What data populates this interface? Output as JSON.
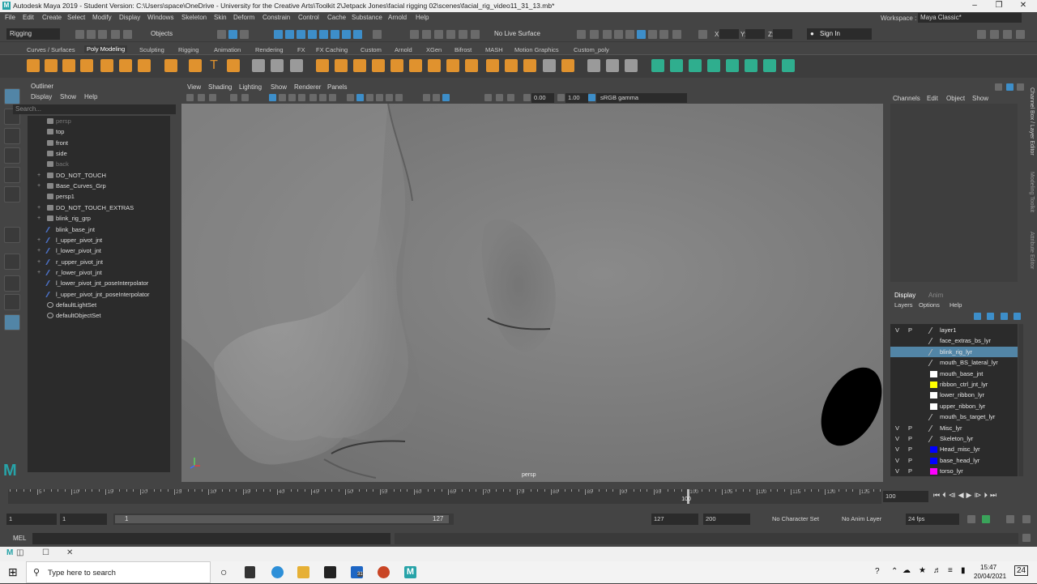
{
  "title_bar": {
    "title": "Autodesk Maya 2019 - Student Version: C:\\Users\\space\\OneDrive - University for the Creative Arts\\Toolkit 2\\Jetpack Jones\\facial rigging 02\\scenes\\facial_rig_video11_31_13.mb*"
  },
  "menu": [
    "File",
    "Edit",
    "Create",
    "Select",
    "Modify",
    "Display",
    "Windows",
    "Skeleton",
    "Skin",
    "Deform",
    "Constrain",
    "Control",
    "Cache",
    "Substance",
    "Arnold",
    "Help"
  ],
  "workspace": {
    "label": "Workspace :",
    "value": "Maya Classic*"
  },
  "status_line": {
    "mode": "Rigging",
    "objects": "Objects",
    "live_surface": "No Live Surface",
    "x_label": "X:",
    "y_label": "Y:",
    "z_label": "Z:",
    "sign_in": "Sign In"
  },
  "shelf_tabs": [
    "Curves / Surfaces",
    "Poly Modeling",
    "Sculpting",
    "Rigging",
    "Animation",
    "Rendering",
    "FX",
    "FX Caching",
    "Custom",
    "Arnold",
    "XGen",
    "Bifrost",
    "MASH",
    "Motion Graphics",
    "Custom_poly"
  ],
  "shelf_active": "Poly Modeling",
  "outliner": {
    "title": "Outliner",
    "menu": [
      "Display",
      "Show",
      "Help"
    ],
    "search_placeholder": "Search...",
    "items": [
      {
        "label": "persp",
        "icon": "camera-icon",
        "dim": true,
        "expand": ""
      },
      {
        "label": "top",
        "icon": "camera-icon",
        "dim": false,
        "expand": ""
      },
      {
        "label": "front",
        "icon": "camera-icon",
        "dim": false,
        "expand": ""
      },
      {
        "label": "side",
        "icon": "camera-icon",
        "dim": false,
        "expand": ""
      },
      {
        "label": "back",
        "icon": "camera-icon",
        "dim": true,
        "expand": ""
      },
      {
        "label": "DO_NOT_TOUCH",
        "icon": "group-icon",
        "dim": false,
        "expand": "+"
      },
      {
        "label": "Base_Curves_Grp",
        "icon": "group-icon",
        "dim": false,
        "expand": "+"
      },
      {
        "label": "persp1",
        "icon": "camera-icon",
        "dim": false,
        "expand": ""
      },
      {
        "label": "DO_NOT_TOUCH_EXTRAS",
        "icon": "group-icon",
        "dim": false,
        "expand": "+"
      },
      {
        "label": "blink_rig_grp",
        "icon": "group-icon",
        "dim": false,
        "expand": "+"
      },
      {
        "label": "blink_base_jnt",
        "icon": "joint-icon",
        "dim": false,
        "expand": ""
      },
      {
        "label": "l_upper_pivot_jnt",
        "icon": "joint-icon",
        "dim": false,
        "expand": "+"
      },
      {
        "label": "l_lower_pivot_jnt",
        "icon": "joint-icon",
        "dim": false,
        "expand": "+"
      },
      {
        "label": "r_upper_pivot_jnt",
        "icon": "joint-icon",
        "dim": false,
        "expand": "+"
      },
      {
        "label": "r_lower_pivot_jnt",
        "icon": "joint-icon",
        "dim": false,
        "expand": "+"
      },
      {
        "label": "l_lower_pivot_jnt_poseInterpolator",
        "icon": "pose-icon",
        "dim": false,
        "expand": ""
      },
      {
        "label": "l_upper_pivot_jnt_poseInterpolator",
        "icon": "pose-icon",
        "dim": false,
        "expand": ""
      },
      {
        "label": "defaultLightSet",
        "icon": "set-icon",
        "dim": false,
        "expand": ""
      },
      {
        "label": "defaultObjectSet",
        "icon": "set-icon",
        "dim": false,
        "expand": ""
      }
    ]
  },
  "viewport": {
    "menu": [
      "View",
      "Shading",
      "Lighting",
      "Show",
      "Renderer",
      "Panels"
    ],
    "exposure": "0.00",
    "gamma_value": "1.00",
    "color_space": "sRGB gamma",
    "camera_label": "persp"
  },
  "channel_box": {
    "menu": [
      "Channels",
      "Edit",
      "Object",
      "Show"
    ]
  },
  "layer_editor": {
    "tabs": [
      "Display",
      "Anim"
    ],
    "menu": [
      "Layers",
      "Options",
      "Help"
    ],
    "layers": [
      {
        "v": "V",
        "p": "P",
        "color": "",
        "name": "layer1",
        "selected": false
      },
      {
        "v": "",
        "p": "",
        "color": "",
        "name": "face_extras_bs_lyr",
        "selected": false
      },
      {
        "v": "",
        "p": "",
        "color": "",
        "name": "blink_rig_lyr",
        "selected": true
      },
      {
        "v": "",
        "p": "",
        "color": "",
        "name": "mouth_BS_lateral_lyr",
        "selected": false
      },
      {
        "v": "",
        "p": "",
        "color": "#ffffff",
        "name": "mouth_base_jnt",
        "selected": false
      },
      {
        "v": "",
        "p": "",
        "color": "#ffff00",
        "name": "ribbon_ctrl_jnt_lyr",
        "selected": false
      },
      {
        "v": "",
        "p": "",
        "color": "#ffffff",
        "name": "lower_ribbon_lyr",
        "selected": false
      },
      {
        "v": "",
        "p": "",
        "color": "#ffffff",
        "name": "upper_ribbon_lyr",
        "selected": false
      },
      {
        "v": "",
        "p": "",
        "color": "",
        "name": "mouth_bs_target_lyr",
        "selected": false
      },
      {
        "v": "V",
        "p": "P",
        "color": "",
        "name": "Misc_lyr",
        "selected": false
      },
      {
        "v": "V",
        "p": "P",
        "color": "",
        "name": "Skeleton_lyr",
        "selected": false
      },
      {
        "v": "V",
        "p": "P",
        "color": "#0000ff",
        "name": "Head_misc_lyr",
        "selected": false
      },
      {
        "v": "V",
        "p": "P",
        "color": "#0000ff",
        "name": "base_head_lyr",
        "selected": false
      },
      {
        "v": "V",
        "p": "P",
        "color": "#ff00ff",
        "name": "torso_lyr",
        "selected": false
      }
    ]
  },
  "side_tabs": [
    "Channel Box / Layer Editor",
    "Modeling Toolkit",
    "Attribute Editor"
  ],
  "time_slider": {
    "ticks": [
      "5",
      "10",
      "15",
      "20",
      "25",
      "30",
      "35",
      "40",
      "45",
      "50",
      "55",
      "60",
      "65",
      "70",
      "75",
      "80",
      "85",
      "90",
      "95",
      "100",
      "105",
      "110",
      "115",
      "120",
      "125"
    ],
    "current_frame": "100",
    "current_marker": 100,
    "max_frame": 128
  },
  "range_slider": {
    "start": "1",
    "playback_start": "1",
    "range_start": "1",
    "range_end": "127",
    "playback_end": "127",
    "end": "200",
    "character_set": "No Character Set",
    "anim_layer": "No Anim Layer",
    "fps": "24 fps"
  },
  "command_line": {
    "label": "MEL"
  },
  "taskbar": {
    "search": "Type here to search",
    "time": "15:47",
    "date": "20/04/2021",
    "notifications": "24",
    "calendar_badge": "31"
  }
}
